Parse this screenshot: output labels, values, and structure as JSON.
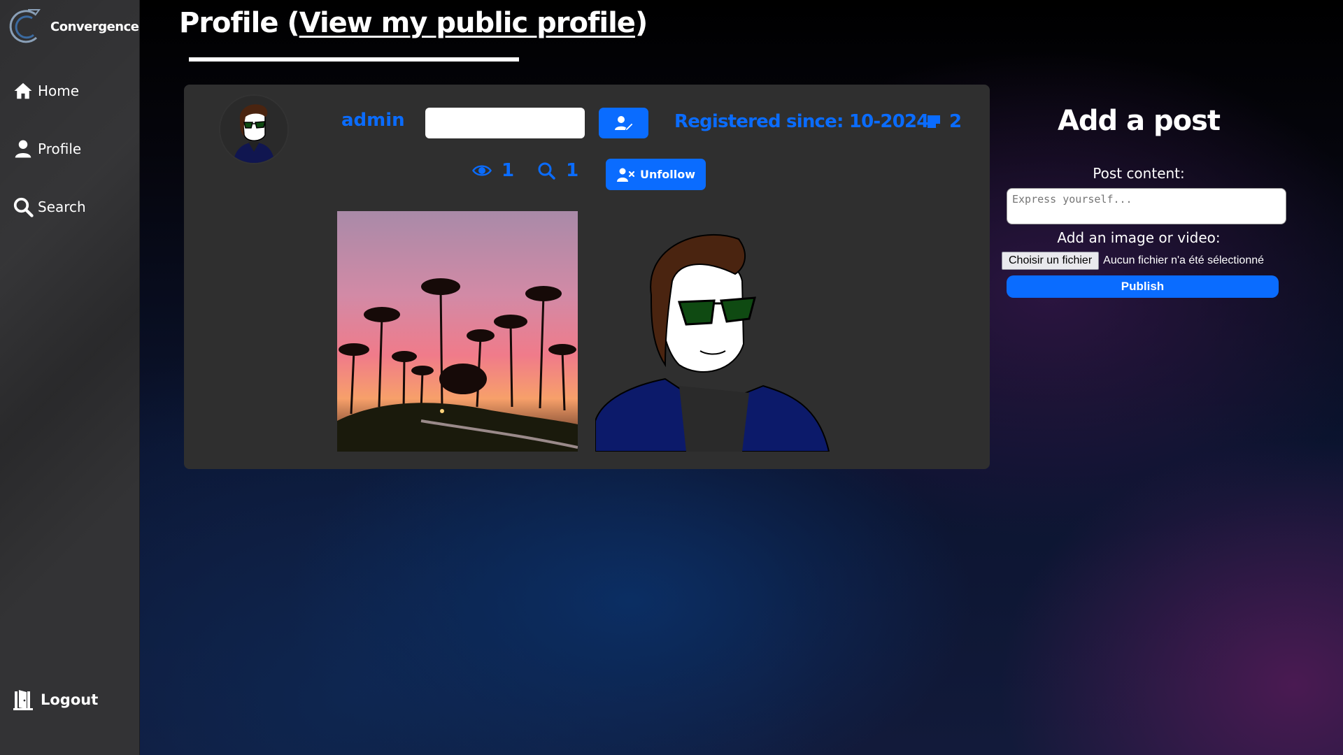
{
  "brand": {
    "name": "Convergence",
    "logo_icon": "convergence-logo"
  },
  "nav": {
    "home": {
      "label": "Home",
      "icon": "home-icon"
    },
    "profile": {
      "label": "Profile",
      "icon": "user-icon"
    },
    "search": {
      "label": "Search",
      "icon": "search-icon"
    },
    "logout": {
      "label": "Logout",
      "icon": "door-exit-icon"
    }
  },
  "page": {
    "title_prefix": "Profile (",
    "title_link": "View my public profile",
    "title_suffix": ")"
  },
  "profile": {
    "username": "admin",
    "bio_value": "",
    "registered": "Registered since: 10-2024",
    "posts_count": "2",
    "views_count": "1",
    "searches_count": "1",
    "unfollow_label": "Unfollow"
  },
  "posts": [
    {
      "type": "image",
      "subject": "palm trees at sunset"
    },
    {
      "type": "image",
      "subject": "cartoon man with sunglasses"
    }
  ],
  "add_post": {
    "title": "Add a post",
    "content_label": "Post content:",
    "content_placeholder": "Express yourself...",
    "media_label": "Add an image or video:",
    "file_button": "Choisir un fichier",
    "file_status": "Aucun fichier n'a été sélectionné",
    "publish_label": "Publish"
  },
  "colors": {
    "accent": "#0a6cff",
    "sidebar": "#2f2f31",
    "card": "#2f2f2f"
  }
}
